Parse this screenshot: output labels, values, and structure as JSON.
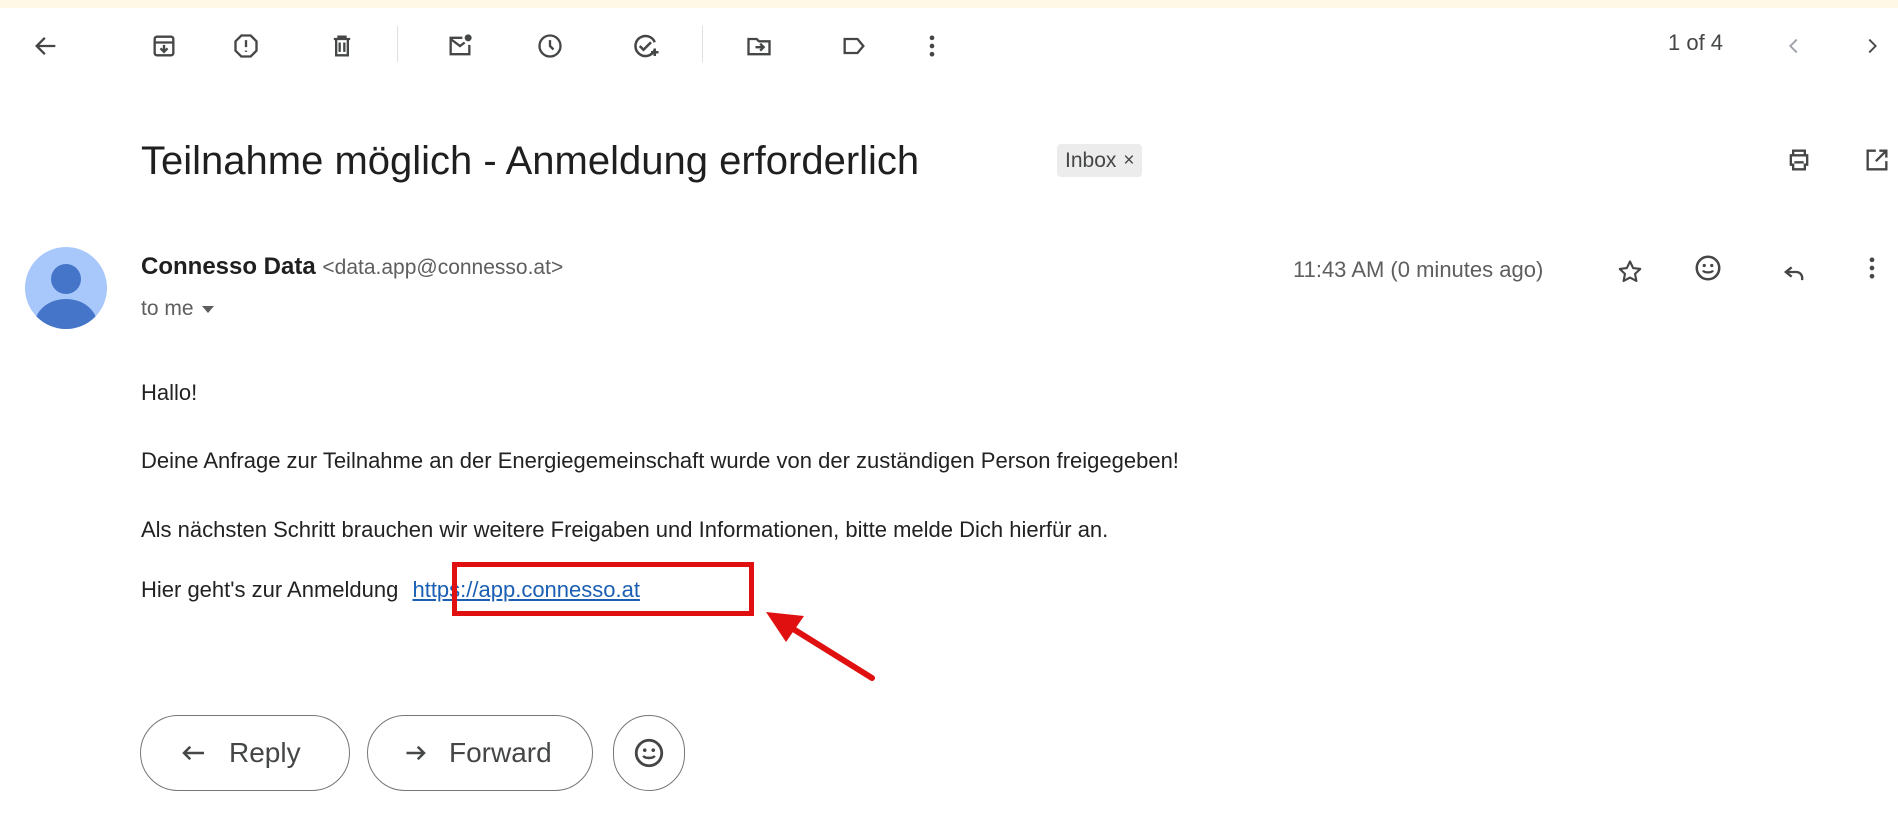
{
  "toolbar": {
    "pager_text": "1 of 4"
  },
  "email": {
    "subject": "Teilnahme möglich - Anmeldung erforderlich",
    "label_chip": "Inbox",
    "label_remove": "×",
    "sender_name": "Connesso Data",
    "sender_email": "<data.app@connesso.at>",
    "recipient": "to me",
    "timestamp": "11:43 AM (0 minutes ago)",
    "body": {
      "greeting": "Hallo!",
      "line1": "Deine Anfrage zur Teilnahme an der Energiegemeinschaft wurde von der zuständigen Person freigegeben!",
      "line2": "Als nächsten Schritt brauchen wir weitere Freigaben und Informationen, bitte melde Dich hierfür an.",
      "line3_prefix": "Hier geht's zur Anmeldung",
      "link": "https://app.connesso.at"
    }
  },
  "actions": {
    "reply": "Reply",
    "forward": "Forward"
  },
  "colors": {
    "accent_link": "#1a5fb4",
    "highlight": "#e01010",
    "avatar_bg": "#a8c7fa",
    "avatar_fg": "#4475c8"
  }
}
